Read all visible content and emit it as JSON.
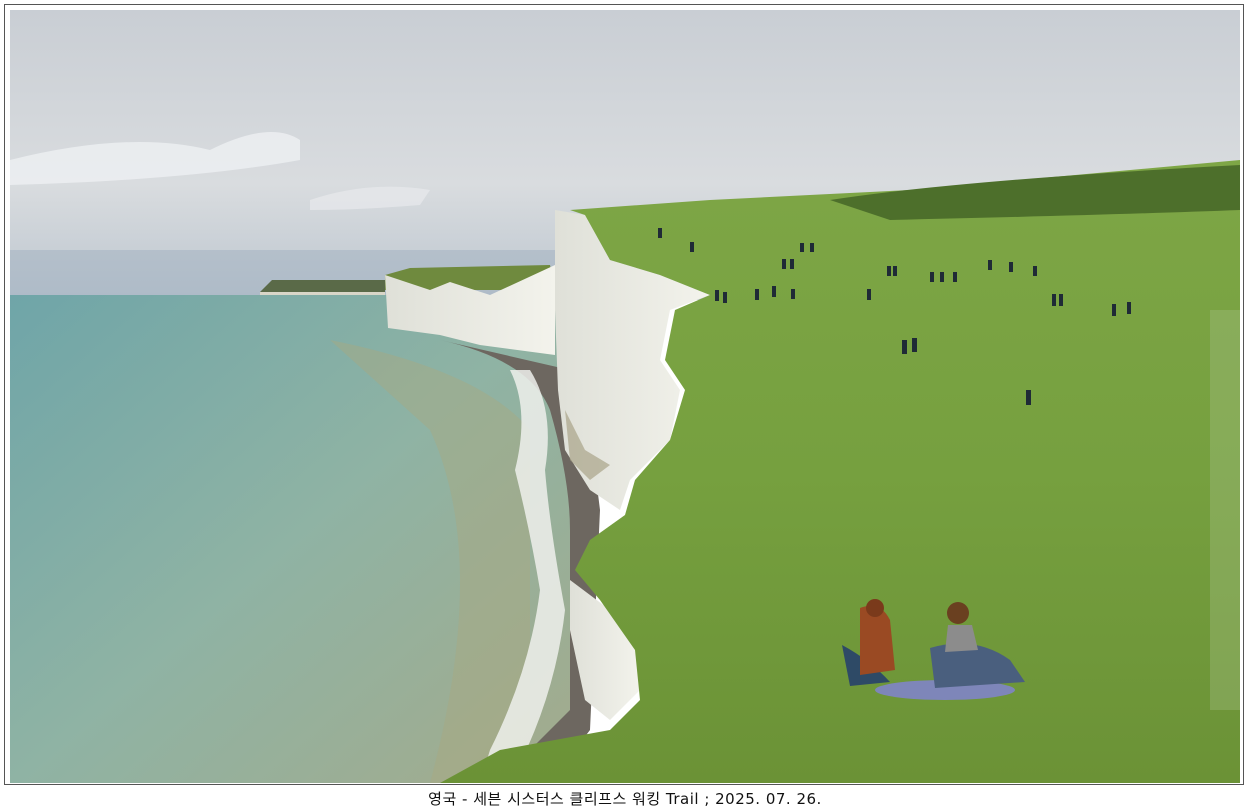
{
  "photo": {
    "subject": "seven-sisters-cliffs-landscape",
    "colors": {
      "sky": "#d6dade",
      "sea": "#7aa9a4",
      "cliff": "#ecece4",
      "grass": "#6f9a3b"
    }
  },
  "caption": {
    "text": "영국  - 세븐 시스터스 클리프스 워킹 Trail ; 2025. 07. 26."
  }
}
